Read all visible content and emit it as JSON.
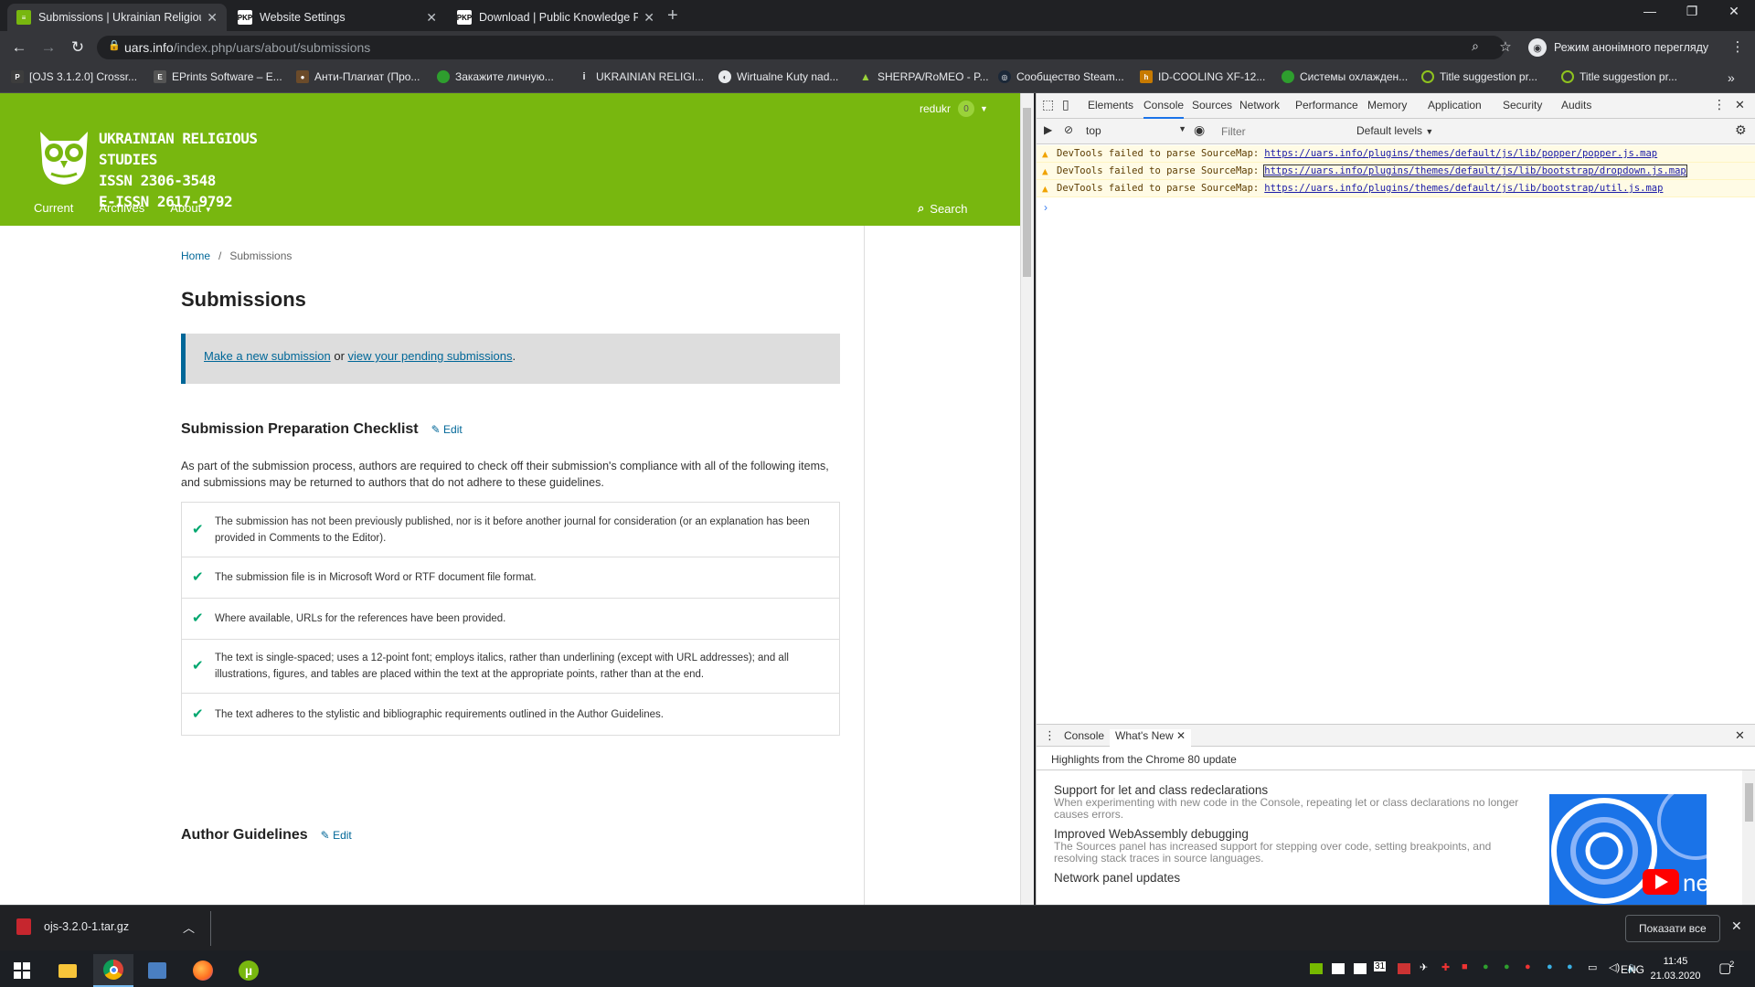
{
  "tabs": [
    {
      "title": "Submissions | Ukrainian Religious",
      "icon": "ojs-favicon",
      "active": true
    },
    {
      "title": "Website Settings",
      "icon": "pkp-favicon",
      "active": false
    },
    {
      "title": "Download | Public Knowledge Pr",
      "icon": "pkp-favicon",
      "active": false
    }
  ],
  "address": {
    "host": "uars.info",
    "path": "/index.php/uars/about/submissions"
  },
  "incognito_label": "Режим анонімного перегляду",
  "bookmarks": [
    {
      "label": "[OJS 3.1.2.0] Crossr...",
      "icon": "pkp-icon",
      "color": "#3d3d3d"
    },
    {
      "label": "EPrints Software – E...",
      "icon": "eprints-icon",
      "color": "#555"
    },
    {
      "label": "Анти-Плагиат (Про...",
      "icon": "person-icon",
      "color": "#6b4b2a"
    },
    {
      "label": "Закажите личную...",
      "icon": "green-circle-icon",
      "color": "#2e9e2e"
    },
    {
      "label": "UKRAINIAN RELIGI...",
      "icon": "info-icon",
      "color": "#35363a"
    },
    {
      "label": "Wirtualne Kuty nad...",
      "icon": "globe-icon",
      "color": "#e8eaed"
    },
    {
      "label": "SHERPA/RoMEO - P...",
      "icon": "sherpa-icon",
      "color": "#35363a"
    },
    {
      "label": "Сообщество Steam...",
      "icon": "steam-icon",
      "color": "#1b2838"
    },
    {
      "label": "ID-COOLING XF-12...",
      "icon": "h-icon",
      "color": "#c77a00"
    },
    {
      "label": "Системы охлажден...",
      "icon": "green-circle-icon",
      "color": "#2e9e2e"
    },
    {
      "label": "Title suggestion pr...",
      "icon": "green-ring-icon",
      "color": "#8fc31f"
    },
    {
      "label": "Title suggestion pr...",
      "icon": "green-ring-icon",
      "color": "#8fc31f"
    }
  ],
  "ojs": {
    "journal_lines": [
      "Ukrainian Religious Studies",
      "ISSN 2306-3548",
      "E-ISSN 2617-9792"
    ],
    "username": "redukr",
    "notifications": "0",
    "nav": [
      "Current",
      "Archives",
      "About"
    ],
    "search_label": "Search",
    "header_color": "#78b70f"
  },
  "page": {
    "breadcrumb": {
      "home": "Home",
      "sep": "/",
      "current": "Submissions"
    },
    "title": "Submissions",
    "notice": {
      "link1": "Make a new submission",
      "middle": " or ",
      "link2": "view your pending submissions",
      "end": "."
    },
    "checklist_heading": "Submission Preparation Checklist",
    "edit_label": "Edit",
    "intro": "As part of the submission process, authors are required to check off their submission's compliance with all of the following items, and submissions may be returned to authors that do not adhere to these guidelines.",
    "checklist": [
      "The submission has not been previously published, nor is it before another journal for consideration (or an explanation has been provided in Comments to the Editor).",
      "The submission file is in Microsoft Word or RTF document file format.",
      "Where available, URLs for the references have been provided.",
      "The text is single-spaced; uses a 12-point font; employs italics, rather than underlining (except with URL addresses); and all illustrations, figures, and tables are placed within the text at the appropriate points, rather than at the end.",
      "The text adheres to the stylistic and bibliographic requirements outlined in the Author Guidelines."
    ],
    "author_heading": "Author Guidelines"
  },
  "devtools": {
    "tabs": [
      "Elements",
      "Console",
      "Sources",
      "Network",
      "Performance",
      "Memory",
      "Application",
      "Security",
      "Audits"
    ],
    "active_tab": "Console",
    "context": "top",
    "filter_placeholder": "Filter",
    "levels": "Default levels",
    "messages": [
      {
        "text": "DevTools failed to parse SourceMap:",
        "url": "https://uars.info/plugins/themes/default/js/lib/popper/popper.js.map"
      },
      {
        "text": "DevTools failed to parse SourceMap:",
        "url": "https://uars.info/plugins/themes/default/js/lib/bootstrap/dropdown.js.map"
      },
      {
        "text": "DevTools failed to parse SourceMap:",
        "url": "https://uars.info/plugins/themes/default/js/lib/bootstrap/util.js.map"
      }
    ],
    "prompt": "›",
    "drawer_tabs": [
      "Console",
      "What's New"
    ],
    "drawer_header": "Highlights from the Chrome 80 update",
    "whats_new": [
      {
        "title": "Support for let and class redeclarations",
        "desc": "When experimenting with new code in the Console, repeating let or class declarations no longer causes errors."
      },
      {
        "title": "Improved WebAssembly debugging",
        "desc": "The Sources panel has increased support for stepping over code, setting breakpoints, and resolving stack traces in source languages."
      },
      {
        "title": "Network panel updates",
        "desc": ""
      }
    ],
    "promo_text": "ne"
  },
  "download": {
    "file": "ojs-3.2.0-1.tar.gz",
    "show_all": "Показати все"
  },
  "taskbar": {
    "lang": "ENG",
    "time": "11:45",
    "date": "21.03.2020",
    "notif_count": "2",
    "calendar_day": "31"
  }
}
